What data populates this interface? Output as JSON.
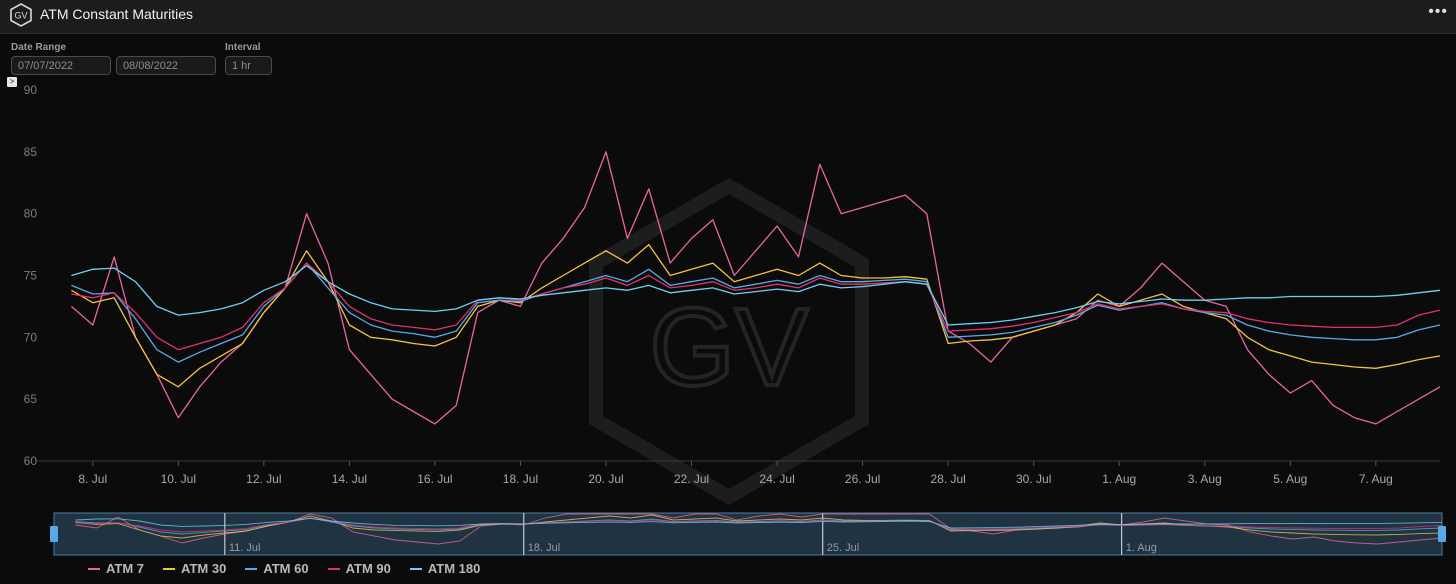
{
  "header": {
    "title": "ATM Constant Maturities"
  },
  "controls": {
    "date_range_label": "Date Range",
    "start_date": "07/07/2022",
    "end_date": "08/08/2022",
    "interval_label": "Interval",
    "interval": "1 hr"
  },
  "watermark": "GV",
  "legend": [
    {
      "name": "ATM 7",
      "color": "#e8679b"
    },
    {
      "name": "ATM 30",
      "color": "#f3c43f"
    },
    {
      "name": "ATM 60",
      "color": "#5aa9e6"
    },
    {
      "name": "ATM 90",
      "color": "#e0336d"
    },
    {
      "name": "ATM 180",
      "color": "#6cd0f5"
    }
  ],
  "chart_data": {
    "type": "line",
    "title": "ATM Constant Maturities",
    "xlabel": "",
    "ylabel": "",
    "ylim": [
      60,
      90
    ],
    "yticks": [
      60,
      65,
      70,
      75,
      80,
      85,
      90
    ],
    "xlim": [
      "2022-07-07T00:00",
      "2022-08-08T12:00"
    ],
    "xticks": [
      {
        "date": "2022-07-08",
        "label": "8. Jul"
      },
      {
        "date": "2022-07-10",
        "label": "10. Jul"
      },
      {
        "date": "2022-07-12",
        "label": "12. Jul"
      },
      {
        "date": "2022-07-14",
        "label": "14. Jul"
      },
      {
        "date": "2022-07-16",
        "label": "16. Jul"
      },
      {
        "date": "2022-07-18",
        "label": "18. Jul"
      },
      {
        "date": "2022-07-20",
        "label": "20. Jul"
      },
      {
        "date": "2022-07-22",
        "label": "22. Jul"
      },
      {
        "date": "2022-07-24",
        "label": "24. Jul"
      },
      {
        "date": "2022-07-26",
        "label": "26. Jul"
      },
      {
        "date": "2022-07-28",
        "label": "28. Jul"
      },
      {
        "date": "2022-07-30",
        "label": "30. Jul"
      },
      {
        "date": "2022-08-01",
        "label": "1. Aug"
      },
      {
        "date": "2022-08-03",
        "label": "3. Aug"
      },
      {
        "date": "2022-08-05",
        "label": "5. Aug"
      },
      {
        "date": "2022-08-07",
        "label": "7. Aug"
      }
    ],
    "navigator_ticks": [
      {
        "date": "2022-07-11",
        "label": "11. Jul"
      },
      {
        "date": "2022-07-18",
        "label": "18. Jul"
      },
      {
        "date": "2022-07-25",
        "label": "25. Jul"
      },
      {
        "date": "2022-08-01",
        "label": "1. Aug"
      }
    ],
    "x": [
      "2022-07-07T12:00",
      "2022-07-08T00:00",
      "2022-07-08T12:00",
      "2022-07-09T00:00",
      "2022-07-09T12:00",
      "2022-07-10T00:00",
      "2022-07-10T12:00",
      "2022-07-11T00:00",
      "2022-07-11T12:00",
      "2022-07-12T00:00",
      "2022-07-12T12:00",
      "2022-07-13T00:00",
      "2022-07-13T12:00",
      "2022-07-14T00:00",
      "2022-07-14T12:00",
      "2022-07-15T00:00",
      "2022-07-15T12:00",
      "2022-07-16T00:00",
      "2022-07-16T12:00",
      "2022-07-17T00:00",
      "2022-07-17T12:00",
      "2022-07-18T00:00",
      "2022-07-18T12:00",
      "2022-07-19T00:00",
      "2022-07-19T12:00",
      "2022-07-20T00:00",
      "2022-07-20T12:00",
      "2022-07-21T00:00",
      "2022-07-21T12:00",
      "2022-07-22T00:00",
      "2022-07-22T12:00",
      "2022-07-23T00:00",
      "2022-07-23T12:00",
      "2022-07-24T00:00",
      "2022-07-24T12:00",
      "2022-07-25T00:00",
      "2022-07-25T12:00",
      "2022-07-26T00:00",
      "2022-07-26T12:00",
      "2022-07-27T00:00",
      "2022-07-27T12:00",
      "2022-07-28T00:00",
      "2022-07-28T12:00",
      "2022-07-29T00:00",
      "2022-07-29T12:00",
      "2022-07-30T00:00",
      "2022-07-30T12:00",
      "2022-07-31T00:00",
      "2022-07-31T12:00",
      "2022-08-01T00:00",
      "2022-08-01T12:00",
      "2022-08-02T00:00",
      "2022-08-02T12:00",
      "2022-08-03T00:00",
      "2022-08-03T12:00",
      "2022-08-04T00:00",
      "2022-08-04T12:00",
      "2022-08-05T00:00",
      "2022-08-05T12:00",
      "2022-08-06T00:00",
      "2022-08-06T12:00",
      "2022-08-07T00:00",
      "2022-08-07T12:00",
      "2022-08-08T00:00",
      "2022-08-08T12:00"
    ],
    "series": [
      {
        "name": "ATM 7",
        "color": "#e8679b",
        "values": [
          72.5,
          71.0,
          76.5,
          70.0,
          67.0,
          63.5,
          66.0,
          68.0,
          69.5,
          72.0,
          74.0,
          80.0,
          76.0,
          69.0,
          67.0,
          65.0,
          64.0,
          63.0,
          64.5,
          72.0,
          73.0,
          72.5,
          76.0,
          78.0,
          80.5,
          85.0,
          78.0,
          82.0,
          76.0,
          78.0,
          79.5,
          75.0,
          77.0,
          79.0,
          76.5,
          84.0,
          80.0,
          80.5,
          81.0,
          81.5,
          80.0,
          70.5,
          69.5,
          68.0,
          70.0,
          70.5,
          71.0,
          71.5,
          73.0,
          72.5,
          74.0,
          76.0,
          74.5,
          73.0,
          72.5,
          69.0,
          67.0,
          65.5,
          66.5,
          64.5,
          63.5,
          63.0,
          64.0,
          65.0,
          66.0
        ]
      },
      {
        "name": "ATM 30",
        "color": "#f3c43f",
        "values": [
          73.8,
          72.8,
          73.2,
          70.0,
          67.0,
          66.0,
          67.5,
          68.5,
          69.5,
          72.0,
          74.0,
          77.0,
          74.5,
          71.0,
          70.0,
          69.8,
          69.5,
          69.3,
          70.0,
          72.5,
          73.0,
          72.8,
          74.0,
          75.0,
          76.0,
          77.0,
          76.0,
          77.5,
          75.0,
          75.5,
          76.0,
          74.5,
          75.0,
          75.5,
          75.0,
          76.0,
          75.0,
          74.8,
          74.8,
          74.9,
          74.7,
          69.5,
          69.7,
          69.8,
          70.0,
          70.5,
          71.0,
          72.0,
          73.5,
          72.5,
          73.0,
          73.5,
          72.5,
          72.0,
          71.5,
          70.0,
          69.0,
          68.5,
          68.0,
          67.8,
          67.6,
          67.5,
          67.8,
          68.2,
          68.5
        ]
      },
      {
        "name": "ATM 60",
        "color": "#5aa9e6",
        "values": [
          74.2,
          73.5,
          73.6,
          71.5,
          69.0,
          68.0,
          68.8,
          69.5,
          70.2,
          72.5,
          74.0,
          76.0,
          74.0,
          72.0,
          71.0,
          70.5,
          70.3,
          70.0,
          70.5,
          72.8,
          73.0,
          72.9,
          73.5,
          74.0,
          74.5,
          75.0,
          74.5,
          75.5,
          74.2,
          74.5,
          74.8,
          74.0,
          74.3,
          74.6,
          74.3,
          75.0,
          74.5,
          74.5,
          74.6,
          74.7,
          74.5,
          70.0,
          70.1,
          70.2,
          70.4,
          70.8,
          71.2,
          71.8,
          72.6,
          72.2,
          72.5,
          72.8,
          72.3,
          72.0,
          71.8,
          71.0,
          70.5,
          70.2,
          70.0,
          69.9,
          69.8,
          69.8,
          70.0,
          70.6,
          71.0
        ]
      },
      {
        "name": "ATM 90",
        "color": "#e0336d",
        "values": [
          73.5,
          73.2,
          73.6,
          72.0,
          70.0,
          69.0,
          69.5,
          70.0,
          70.8,
          72.8,
          74.0,
          76.0,
          74.5,
          72.5,
          71.5,
          71.0,
          70.8,
          70.6,
          71.0,
          73.0,
          73.2,
          73.0,
          73.5,
          74.0,
          74.3,
          74.8,
          74.2,
          75.0,
          74.0,
          74.2,
          74.5,
          73.8,
          74.0,
          74.3,
          74.0,
          74.8,
          74.3,
          74.3,
          74.4,
          74.5,
          74.3,
          70.5,
          70.6,
          70.7,
          70.9,
          71.2,
          71.6,
          72.0,
          72.7,
          72.3,
          72.5,
          72.7,
          72.3,
          72.1,
          72.0,
          71.5,
          71.2,
          71.0,
          70.9,
          70.8,
          70.8,
          70.8,
          71.0,
          71.8,
          72.2
        ]
      },
      {
        "name": "ATM 180",
        "color": "#6cd0f5",
        "values": [
          75.0,
          75.5,
          75.6,
          74.5,
          72.5,
          71.8,
          72.0,
          72.3,
          72.8,
          73.8,
          74.5,
          75.8,
          74.5,
          73.5,
          72.8,
          72.3,
          72.2,
          72.1,
          72.3,
          73.0,
          73.2,
          73.1,
          73.4,
          73.6,
          73.8,
          74.0,
          73.8,
          74.2,
          73.6,
          73.8,
          74.0,
          73.5,
          73.7,
          73.9,
          73.7,
          74.3,
          74.0,
          74.1,
          74.3,
          74.5,
          74.3,
          71.0,
          71.1,
          71.2,
          71.4,
          71.7,
          72.0,
          72.4,
          72.9,
          72.7,
          72.9,
          73.1,
          73.0,
          73.0,
          73.1,
          73.2,
          73.2,
          73.3,
          73.3,
          73.3,
          73.3,
          73.3,
          73.4,
          73.6,
          73.8
        ]
      }
    ]
  }
}
